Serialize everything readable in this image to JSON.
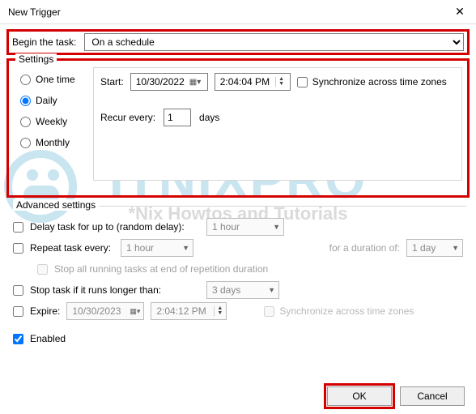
{
  "window": {
    "title": "New Trigger"
  },
  "begin": {
    "label": "Begin the task:",
    "value": "On a schedule"
  },
  "settings": {
    "legend": "Settings",
    "radios": {
      "one_time": "One time",
      "daily": "Daily",
      "weekly": "Weekly",
      "monthly": "Monthly",
      "selected": "daily"
    },
    "start_label": "Start:",
    "date": "10/30/2022",
    "time": "2:04:04 PM",
    "sync_label": "Synchronize across time zones",
    "recur_label": "Recur every:",
    "recur_value": "1",
    "recur_unit": "days"
  },
  "advanced": {
    "legend": "Advanced settings",
    "delay_label": "Delay task for up to (random delay):",
    "delay_value": "1 hour",
    "repeat_label": "Repeat task every:",
    "repeat_value": "1 hour",
    "duration_label": "for a duration of:",
    "duration_value": "1 day",
    "stop_all_label": "Stop all running tasks at end of repetition duration",
    "stop_if_label": "Stop task if it runs longer than:",
    "stop_if_value": "3 days",
    "expire_label": "Expire:",
    "expire_date": "10/30/2023",
    "expire_time": "2:04:12 PM",
    "expire_sync_label": "Synchronize across time zones",
    "enabled_label": "Enabled"
  },
  "buttons": {
    "ok": "OK",
    "cancel": "Cancel"
  },
  "watermark": {
    "big": "ITNIXPRO",
    "sub": "*Nix Howtos and Tutorials"
  }
}
